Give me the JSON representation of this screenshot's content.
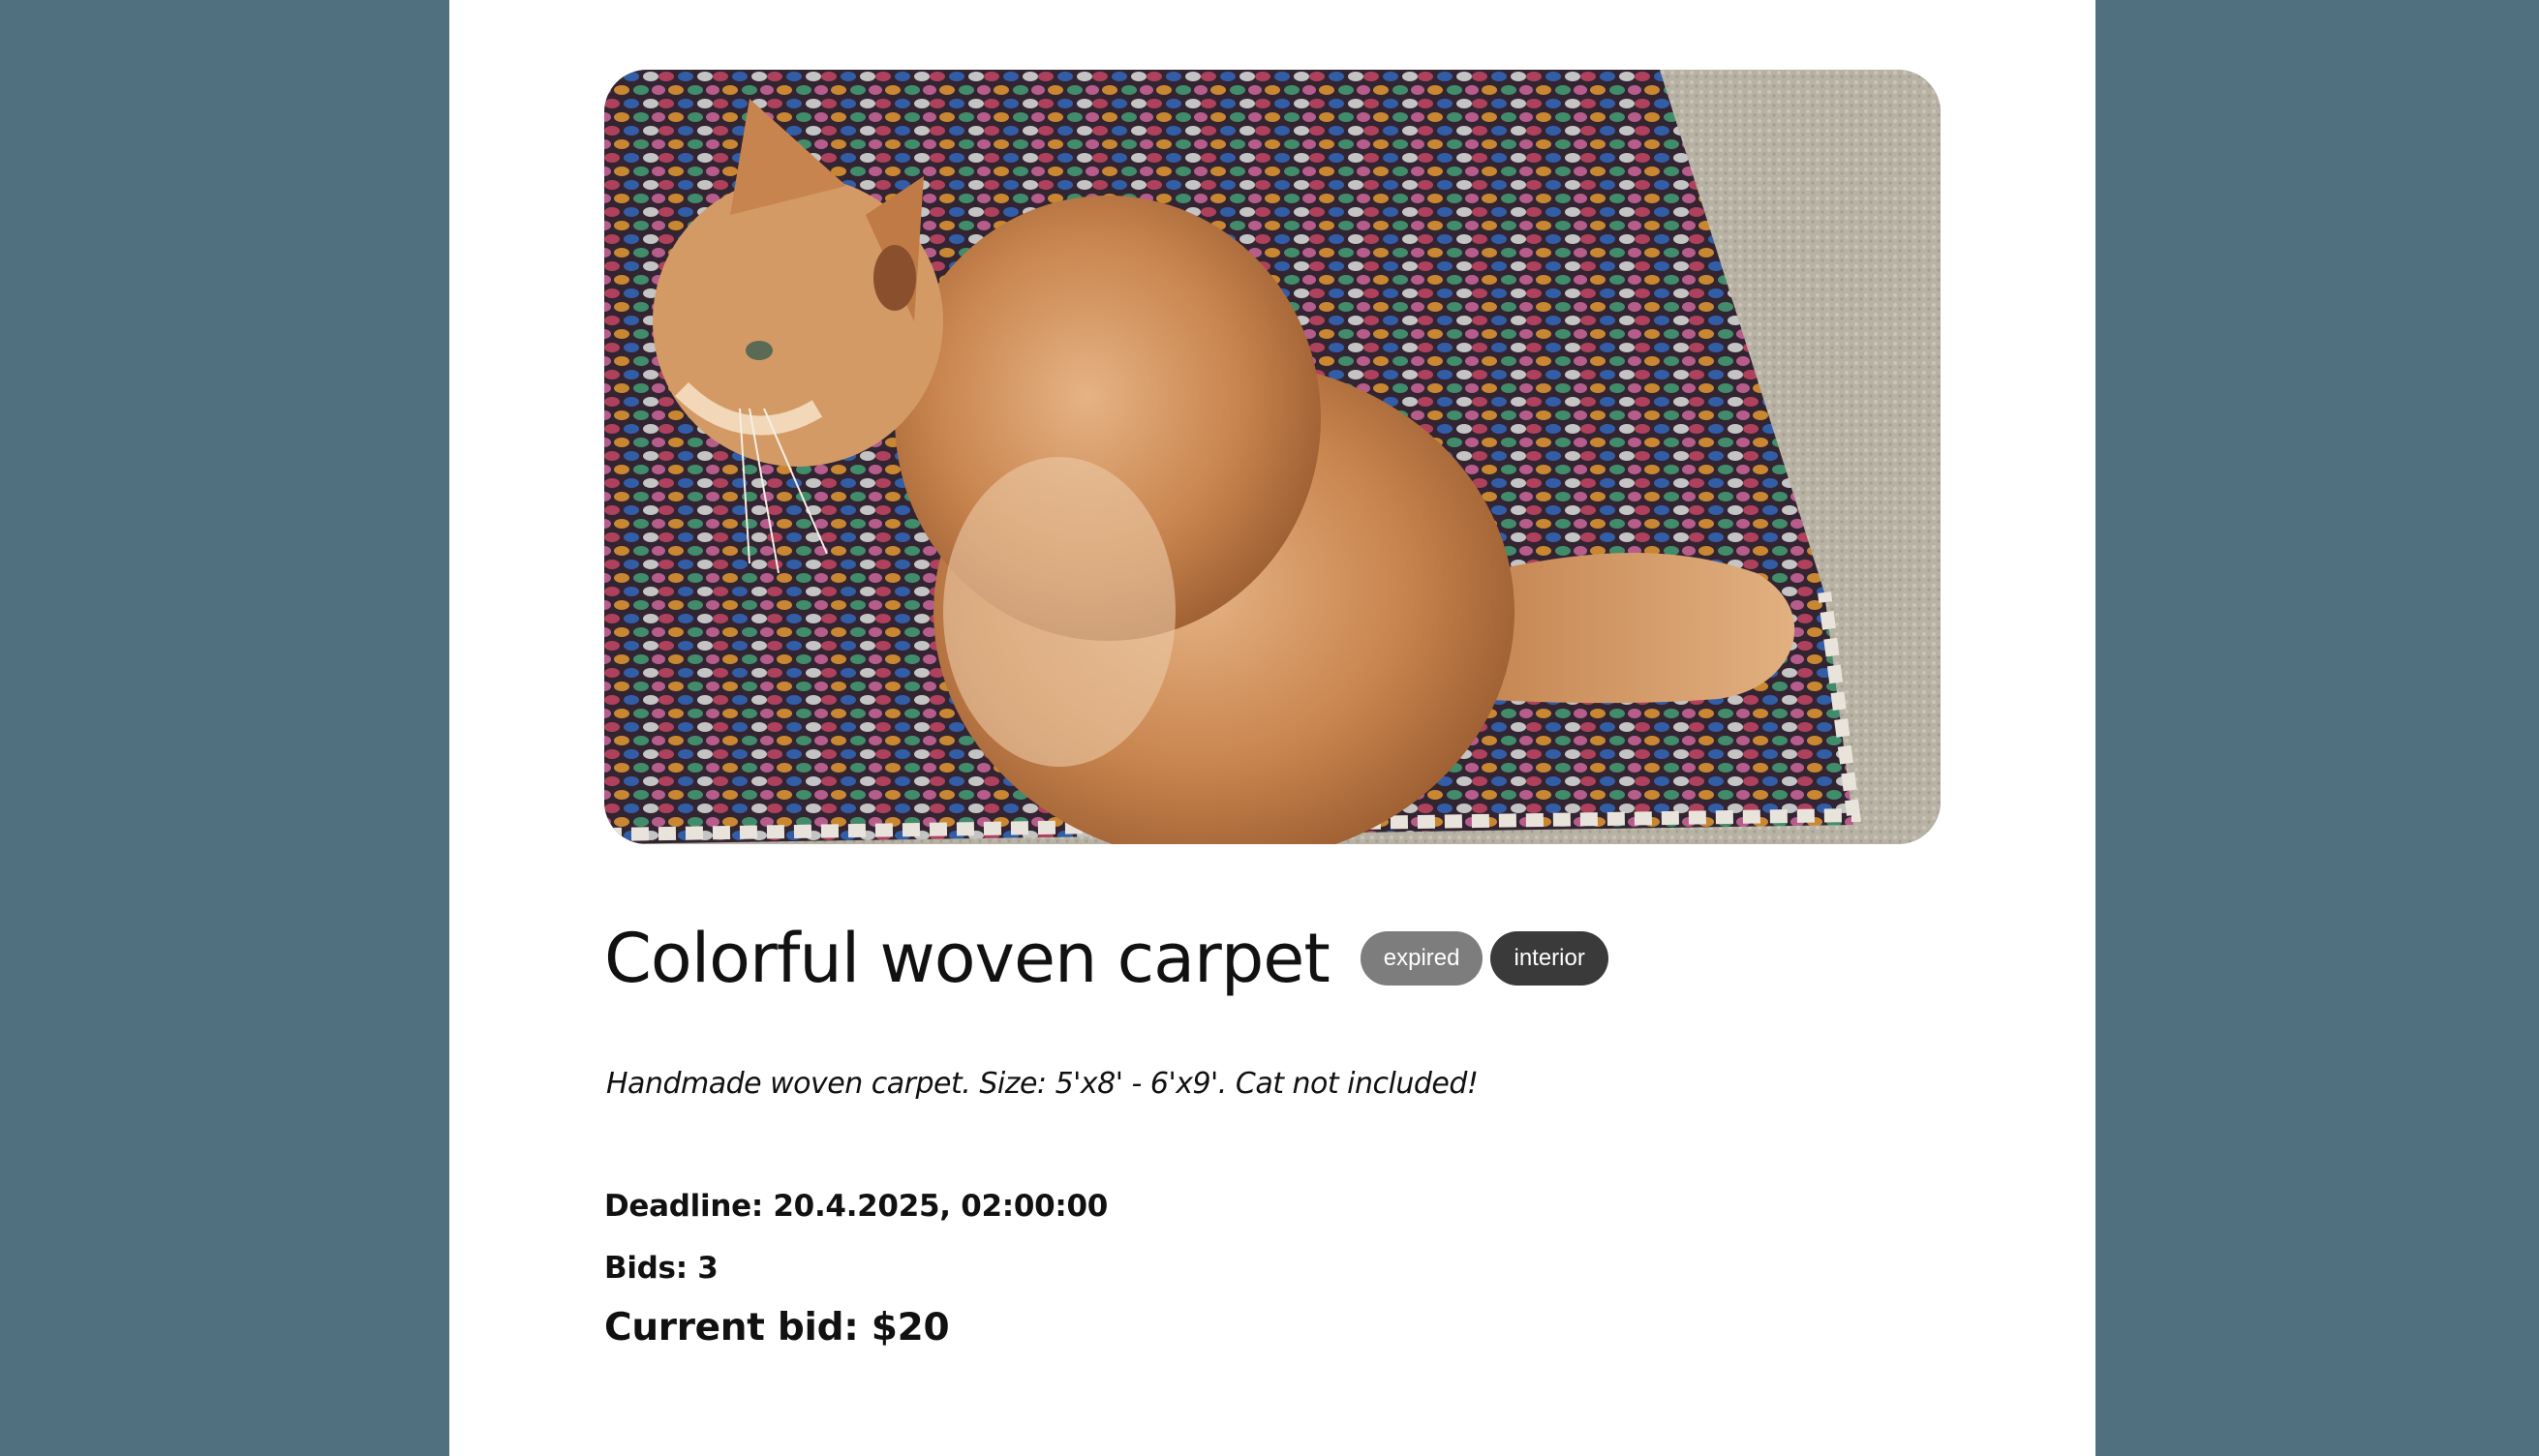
{
  "item": {
    "title": "Colorful woven carpet",
    "tags": [
      {
        "label": "expired",
        "color": "#7d7d7d"
      },
      {
        "label": "interior",
        "color": "#3a3a3a"
      }
    ],
    "description": "Handmade woven carpet. Size: 5'x8' - 6'x9'. Cat not included!",
    "deadline_text": "Deadline: 20.4.2025, 02:00:00",
    "bids_text": "Bids: 3",
    "current_bid_text": "Current bid: $20"
  },
  "colors": {
    "background": "#50707f",
    "panel": "#ffffff",
    "text": "#111111"
  }
}
